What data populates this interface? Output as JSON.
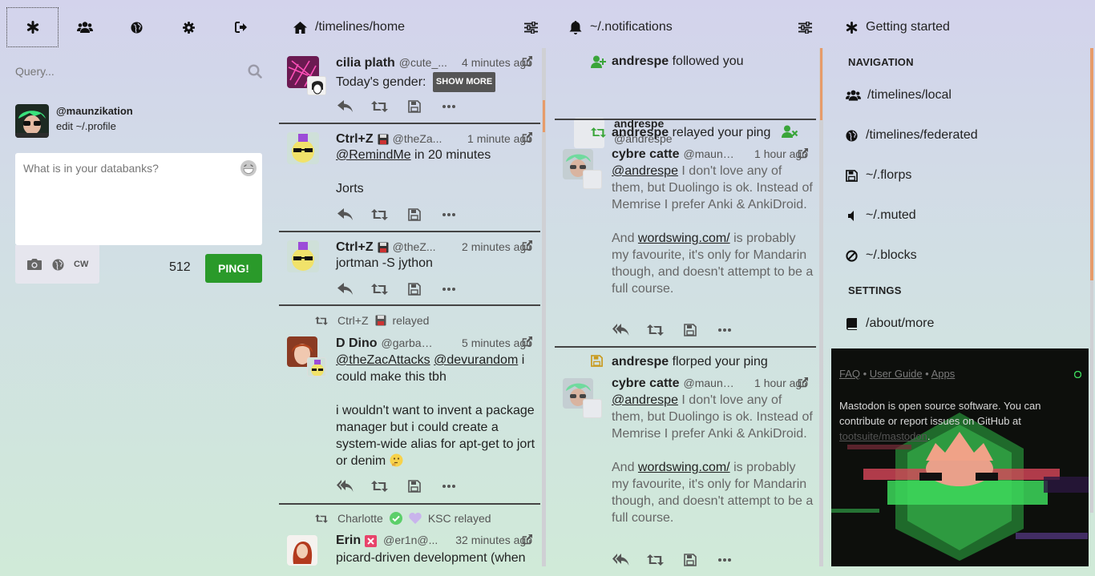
{
  "drawer": {
    "tabs": [
      {
        "icon": "asterisk-icon"
      },
      {
        "icon": "users-icon"
      },
      {
        "icon": "globe-icon"
      },
      {
        "icon": "gear-icon"
      },
      {
        "icon": "sign-out-icon"
      }
    ],
    "search_placeholder": "Query...",
    "account": {
      "handle": "@maunzikation",
      "edit_label": "edit ~/.profile"
    },
    "compose": {
      "placeholder": "What is in your databanks?",
      "cw_label": "CW",
      "char_count": "512",
      "submit_label": "PING!"
    }
  },
  "home": {
    "title": "/timelines/home",
    "statuses": [
      {
        "name": "cilia plath",
        "acct": "@cute_...",
        "time": "4 minutes ago",
        "text": "Today's gender:",
        "show_more": "SHOW MORE"
      },
      {
        "name": "Ctrl+Z",
        "acct": "@theZa...",
        "time": "1 minute ago",
        "mention": "@RemindMe",
        "text": " in 20 minutes",
        "text2": "Jorts"
      },
      {
        "name": "Ctrl+Z",
        "acct": "@theZ...",
        "time": "2 minutes ago",
        "text": "jortman -S jython"
      },
      {
        "relayed_by": "Ctrl+Z",
        "relayed_label": "relayed",
        "name": "D Dino",
        "acct": "@garbado...",
        "time": "5 minutes ago",
        "mention1": "@theZacAttacks",
        "mention2": "@devurandom",
        "text": " i could make this tbh",
        "text2": "i wouldn't want to invent a package manager but i could create a system-wide alias for apt-get to jort or denim"
      },
      {
        "relayed_by": "Charlotte",
        "relayed_by2": "KSC",
        "relayed_label": "relayed",
        "name": "Erin",
        "acct": "@er1n@...",
        "time": "32 minutes ago",
        "text": "picard-driven development (when"
      }
    ]
  },
  "notifications": {
    "title": "~/.notifications",
    "items": [
      {
        "who": "andrespe",
        "action": "followed you",
        "card_name": "andrespe",
        "card_acct": "@andrespe"
      },
      {
        "who": "andrespe",
        "action": "relayed your ping",
        "name": "cybre catte",
        "acct": "@maunzi...",
        "time": "1 hour ago",
        "mention": "@andrespe",
        "text": " I don't love any of them, but Duolingo is ok. Instead of Memrise I prefer Anki & AnkiDroid.",
        "link": "wordswing.com/",
        "text_pre": "And ",
        "text_post": " is probably my favourite, it's only for Mandarin though, and doesn't attempt to be a full course."
      },
      {
        "who": "andrespe",
        "action": "florped your ping",
        "name": "cybre catte",
        "acct": "@maunzi...",
        "time": "1 hour ago",
        "mention": "@andrespe",
        "text": " I don't love any of them, but Duolingo is ok. Instead of Memrise I prefer Anki & AnkiDroid.",
        "link": "wordswing.com/",
        "text_pre": "And ",
        "text_post": " is probably my favourite, it's only for Mandarin though, and doesn't attempt to be a full course."
      }
    ]
  },
  "getting_started": {
    "title": "Getting started",
    "navigation_label": "NAVIGATION",
    "nav": [
      {
        "label": "/timelines/local",
        "icon": "users-icon"
      },
      {
        "label": "/timelines/federated",
        "icon": "globe-icon"
      },
      {
        "label": "~/.florps",
        "icon": "floppy-icon"
      },
      {
        "label": "~/.muted",
        "icon": "volume-off-icon"
      },
      {
        "label": "~/.blocks",
        "icon": "ban-icon"
      }
    ],
    "settings_label": "SETTINGS",
    "settings": [
      {
        "label": "/about/more",
        "icon": "book-icon"
      }
    ],
    "about": {
      "link1": "FAQ",
      "sep": " • ",
      "link2": "User Guide",
      "link3": "Apps",
      "text": "Mastodon is open source software. You can contribute or report issues on GitHub at ",
      "repo": "tootsuite/mastodon",
      "end": "."
    }
  },
  "colors": {
    "accent_green": "#2a9a2a",
    "scroll_orange": "#e79b6a",
    "follow_green": "#3aa53a",
    "florp_yellow": "#c99a1e"
  }
}
